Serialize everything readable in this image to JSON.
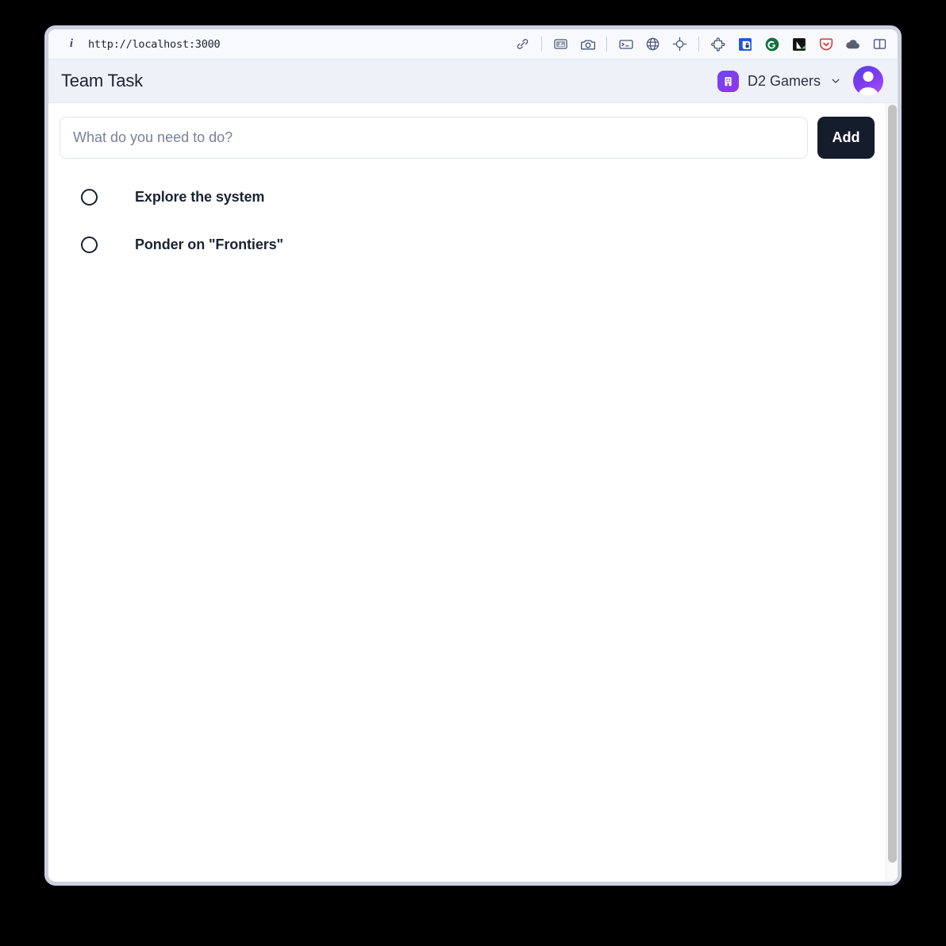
{
  "browser": {
    "url": "http://localhost:3000",
    "info_icon": "info-icon",
    "toolbar_icons": [
      {
        "name": "link-icon"
      },
      {
        "name": "screenshot-region-icon"
      },
      {
        "name": "camera-icon"
      },
      {
        "name": "terminal-icon"
      },
      {
        "name": "globe-icon"
      },
      {
        "name": "crosshair-target-icon"
      },
      {
        "name": "puzzle-extensions-icon"
      },
      {
        "name": "password-manager-icon"
      },
      {
        "name": "grammarly-icon"
      },
      {
        "name": "color-picker-icon"
      },
      {
        "name": "pocket-save-icon"
      },
      {
        "name": "cloud-icon"
      },
      {
        "name": "sidebar-toggle-icon"
      }
    ]
  },
  "header": {
    "title": "Team Task",
    "org_name": "D2 Gamers",
    "org_logo_icon": "building-icon",
    "chevron_icon": "chevron-down-icon",
    "avatar_icon": "user-avatar"
  },
  "compose": {
    "placeholder": "What do you need to do?",
    "value": "",
    "add_label": "Add"
  },
  "tasks": [
    {
      "label": "Explore the system",
      "done": false
    },
    {
      "label": "Ponder on \"Frontiers\"",
      "done": false
    }
  ],
  "colors": {
    "accent_purple": "#7c3aed",
    "button_dark": "#151c2c",
    "header_bg": "#eef1f7",
    "window_border": "#ccd1e2",
    "page_bg": "#000000"
  }
}
